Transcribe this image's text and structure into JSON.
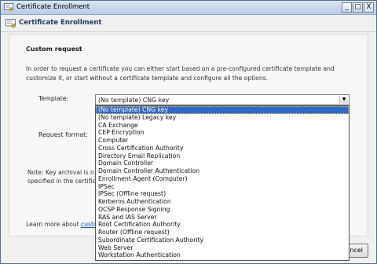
{
  "window": {
    "title": "Certificate Enrollment",
    "caption_buttons": {
      "minimize": "_",
      "maximize": "□",
      "close": "X"
    }
  },
  "header": {
    "title": "Certificate Enrollment"
  },
  "section": {
    "title": "Custom request",
    "description": "In order to request a certificate you can either start based on a pre-configured certificate template and customize it, or start without a certificate template and configure all the options."
  },
  "template": {
    "label": "Template:",
    "selected": "(No template) CNG key",
    "options": [
      "(No template) CNG key",
      "(No template) Legacy key",
      "CA Exchange",
      "CEP Encryption",
      "Computer",
      "Cross Certification Authority",
      "Directory Email Replication",
      "Domain Controller",
      "Domain Controller Authentication",
      "Enrollment Agent (Computer)",
      "IPSec",
      "IPSec (Offline request)",
      "Kerberos Authentication",
      "OCSP Response Signing",
      "RAS and IAS Server",
      "Root Certification Authority",
      "Router (Offline request)",
      "Subordinate Certification Authority",
      "Web Server",
      "Workstation Authentication"
    ]
  },
  "request_format": {
    "label": "Request format:"
  },
  "note": {
    "line1": "Note: Key archival is n",
    "line2": "specified in the certifica"
  },
  "learn_more": {
    "prefix": "Learn more about ",
    "link": "custom"
  },
  "buttons": {
    "cancel": "ncel"
  },
  "colors": {
    "selection": "#3169c6",
    "link": "#1a4ea8",
    "header_title": "#1e3a66"
  }
}
